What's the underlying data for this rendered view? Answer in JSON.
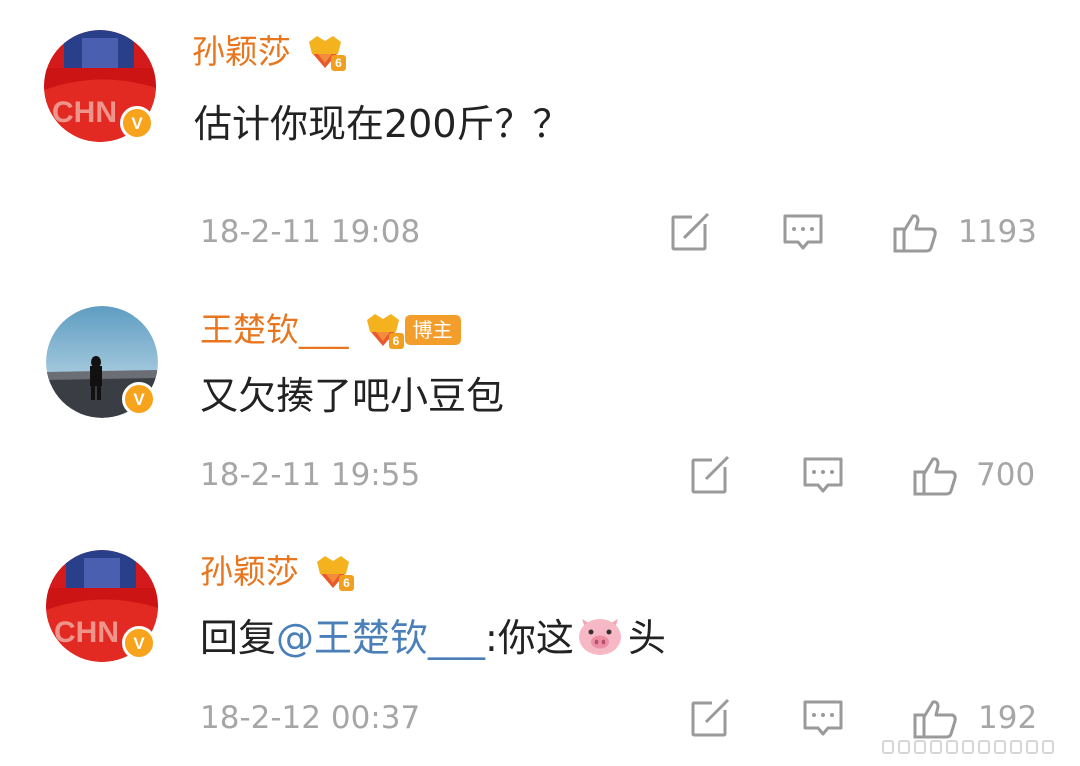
{
  "colors": {
    "username": "#e8761e",
    "text": "#222222",
    "mention": "#4a7fb8",
    "meta": "#a6a6a6",
    "verified_badge": "#f7a31c"
  },
  "comments": [
    {
      "username": "孙颖莎",
      "crown_level": "6",
      "text": "估计你现在200斤？？",
      "timestamp": "18-2-11 19:08",
      "likes": "1193",
      "icons": [
        "crown-icon",
        "repost-icon",
        "comment-icon",
        "like-icon",
        "verified-v-icon"
      ]
    },
    {
      "username": "王楚钦___",
      "crown_level": "6",
      "tag": "博主",
      "text": "又欠揍了吧小豆包",
      "timestamp": "18-2-11 19:55",
      "likes": "700",
      "icons": [
        "crown-icon",
        "repost-icon",
        "comment-icon",
        "like-icon",
        "verified-v-icon"
      ]
    },
    {
      "username": "孙颖莎",
      "crown_level": "6",
      "reply_prefix": "回复",
      "mention": "@王楚钦___",
      "reply_text_before_emoji": ":你这",
      "emoji": "pig-face-emoji",
      "reply_text_after_emoji": "头",
      "timestamp": "18-2-12 00:37",
      "likes": "192",
      "icons": [
        "crown-icon",
        "repost-icon",
        "comment-icon",
        "like-icon",
        "verified-v-icon"
      ]
    }
  ],
  "verified_label": "V"
}
